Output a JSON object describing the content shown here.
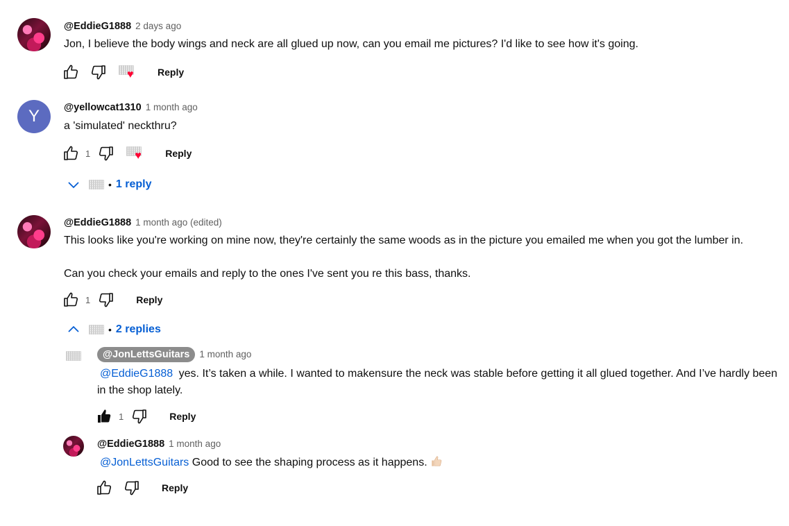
{
  "comments": [
    {
      "author": "@EddieG1888",
      "time": "2 days ago",
      "text": "Jon, I believe the body wings and neck are all glued up now, can you email me pictures? I'd like to see how it's going.",
      "reply_label": "Reply"
    },
    {
      "author": "@yellowcat1310",
      "avatar_letter": "Y",
      "time": "1 month ago",
      "text": "a 'simulated' neckthru?",
      "like_count": "1",
      "reply_label": "Reply",
      "replies_toggle": "1 reply"
    },
    {
      "author": "@EddieG1888",
      "time": "1 month ago (edited)",
      "text_line1": "This looks like you're working on mine now, they're certainly the same woods as in the picture you emailed me when you got the lumber in.",
      "text_line2": "Can you check your emails and reply to the ones I've sent you re this bass, thanks.",
      "like_count": "1",
      "reply_label": "Reply",
      "replies_toggle": "2 replies",
      "replies": [
        {
          "author": "@JonLettsGuitars",
          "time": "1 month ago",
          "mention": "@EddieG1888",
          "text": " yes. It’s taken a while. I wanted to makensure the neck was stable before getting it all glued together. And I’ve hardly been in the shop lately.",
          "like_count": "1",
          "reply_label": "Reply"
        },
        {
          "author": "@EddieG1888",
          "time": "1 month ago",
          "mention": "@JonLettsGuitars",
          "text": " Good to see the shaping process as it happens.",
          "emoji": "thumbs-up-emoji",
          "reply_label": "Reply"
        }
      ]
    }
  ],
  "icons": {
    "like": "thumbs-up-icon",
    "like_filled": "thumbs-up-filled-icon",
    "dislike": "thumbs-down-icon",
    "heart": "heart-icon",
    "expand": "chevron-down-icon",
    "collapse": "chevron-up-icon"
  },
  "colors": {
    "link": "#065fd4",
    "heart": "#ff0033",
    "letter_avatar": "#5c6bc0",
    "author_pill": "#8c8c8c"
  }
}
